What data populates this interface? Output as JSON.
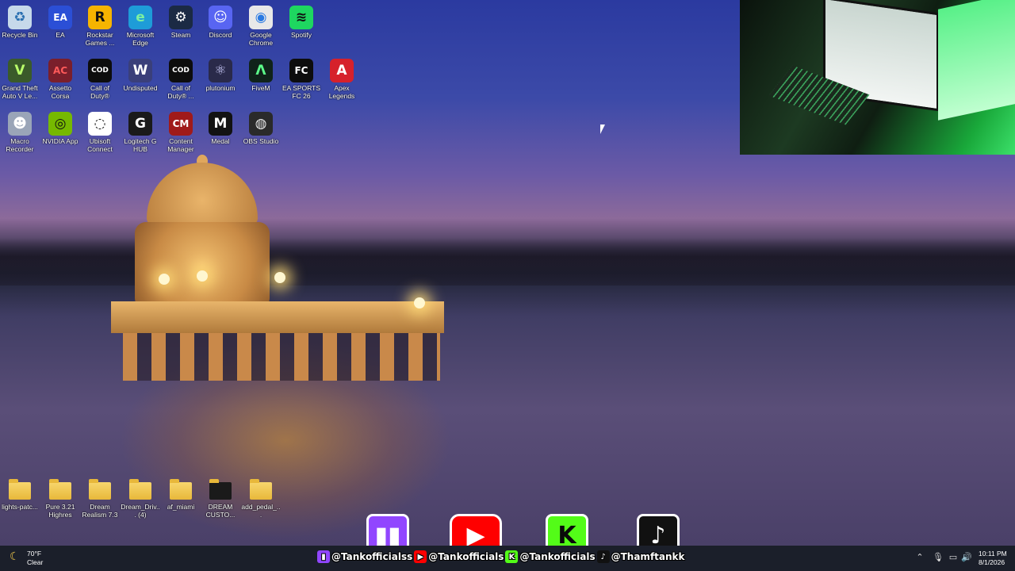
{
  "desktop_icons": [
    {
      "label": "Recycle Bin",
      "icon": "recycle-bin-icon",
      "glyph": "♻",
      "bg": "#c6d9ea",
      "fg": "#2a6fb0"
    },
    {
      "label": "EA",
      "icon": "ea-icon",
      "glyph": "EA",
      "bg": "#2b4fd6",
      "fg": "#ffffff"
    },
    {
      "label": "Rockstar Games ...",
      "icon": "rockstar-icon",
      "glyph": "R",
      "bg": "#f6b400",
      "fg": "#111111"
    },
    {
      "label": "Microsoft Edge",
      "icon": "edge-icon",
      "glyph": "e",
      "bg": "#1e9cd8",
      "fg": "#7cf0a0"
    },
    {
      "label": "Steam",
      "icon": "steam-icon",
      "glyph": "⚙",
      "bg": "#1b2a44",
      "fg": "#ffffff"
    },
    {
      "label": "Discord",
      "icon": "discord-icon",
      "glyph": "☺",
      "bg": "#5865f2",
      "fg": "#ffffff"
    },
    {
      "label": "Google Chrome",
      "icon": "chrome-icon",
      "glyph": "◉",
      "bg": "#e8e8e8",
      "fg": "#2a7ae2"
    },
    {
      "label": "Spotify",
      "icon": "spotify-icon",
      "glyph": "≋",
      "bg": "#1ed760",
      "fg": "#111111"
    },
    {
      "label": "Grand Theft Auto V Le...",
      "icon": "gta-icon",
      "glyph": "V",
      "bg": "#3a5a2a",
      "fg": "#b9ff6a"
    },
    {
      "label": "Assetto Corsa",
      "icon": "assetto-corsa-icon",
      "glyph": "AC",
      "bg": "#7a1f2b",
      "fg": "#ff5a5a"
    },
    {
      "label": "Call of Duty®",
      "icon": "cod-icon",
      "glyph": "COD",
      "bg": "#0d0d0d",
      "fg": "#ffffff"
    },
    {
      "label": "Undisputed",
      "icon": "undisputed-icon",
      "glyph": "W",
      "bg": "#3a3f7a",
      "fg": "#ffffff"
    },
    {
      "label": "Call of Duty® ...",
      "icon": "cod2-icon",
      "glyph": "COD",
      "bg": "#0d0d0d",
      "fg": "#ffffff"
    },
    {
      "label": "plutonium",
      "icon": "plutonium-icon",
      "glyph": "⚛",
      "bg": "#2a2a4a",
      "fg": "#cfcfff"
    },
    {
      "label": "FiveM",
      "icon": "fivem-icon",
      "glyph": "Λ",
      "bg": "#10231a",
      "fg": "#5cff8a"
    },
    {
      "label": "EA SPORTS FC 26",
      "icon": "fc26-icon",
      "glyph": "FC",
      "bg": "#0d0d0d",
      "fg": "#ffffff"
    },
    {
      "label": "Apex Legends",
      "icon": "apex-icon",
      "glyph": "A",
      "bg": "#d6212b",
      "fg": "#ffffff"
    },
    {
      "label": "Macro Recorder",
      "icon": "macro-recorder-icon",
      "glyph": "☻",
      "bg": "#9aa5b8",
      "fg": "#ffffff"
    },
    {
      "label": "NVIDIA App",
      "icon": "nvidia-icon",
      "glyph": "◎",
      "bg": "#76b900",
      "fg": "#111111"
    },
    {
      "label": "Ubisoft Connect",
      "icon": "ubisoft-icon",
      "glyph": "◌",
      "bg": "#ffffff",
      "fg": "#111111"
    },
    {
      "label": "Logitech G HUB",
      "icon": "logitech-icon",
      "glyph": "G",
      "bg": "#1a1a1a",
      "fg": "#ffffff"
    },
    {
      "label": "Content Manager",
      "icon": "content-manager-icon",
      "glyph": "CM",
      "bg": "#a01a1a",
      "fg": "#ffffff"
    },
    {
      "label": "Medal",
      "icon": "medal-icon",
      "glyph": "M",
      "bg": "#121212",
      "fg": "#ffffff"
    },
    {
      "label": "OBS Studio",
      "icon": "obs-icon",
      "glyph": "◍",
      "bg": "#2a2a2a",
      "fg": "#e8e8e8"
    }
  ],
  "folder_icons": [
    {
      "label": "lights-patc..."
    },
    {
      "label": "Pure 3.21 Highres"
    },
    {
      "label": "Dream Realism 7.3"
    },
    {
      "label": "Dream_Driv... (4)"
    },
    {
      "label": "af_miami"
    },
    {
      "label": "DREAM CUSTO..."
    },
    {
      "label": "add_pedal_..."
    }
  ],
  "social_big": [
    {
      "name": "twitch",
      "glyph": "▮▮",
      "bg": "#9146ff",
      "fg": "#ffffff"
    },
    {
      "name": "youtube",
      "glyph": "▶",
      "bg": "#ff0000",
      "fg": "#ffffff"
    },
    {
      "name": "kick",
      "glyph": "K",
      "bg": "#53fc18",
      "fg": "#0a0a0a"
    },
    {
      "name": "tiktok",
      "glyph": "♪",
      "bg": "#111111",
      "fg": "#ffffff"
    }
  ],
  "social_handles": [
    {
      "platform": "twitch",
      "text": "@Tankofficialss",
      "badge": "#9146ff",
      "glyph": "▮"
    },
    {
      "platform": "youtube",
      "text": "@Tankofficials",
      "badge": "#ff0000",
      "glyph": "▶"
    },
    {
      "platform": "kick",
      "text": "@Tankofficials",
      "badge": "#53fc18",
      "glyph": "K"
    },
    {
      "platform": "tiktok",
      "text": "@Thamftankk",
      "badge": "#111111",
      "glyph": "♪"
    }
  ],
  "taskbar": {
    "weather": {
      "temp": "70°F",
      "condition": "Clear",
      "icon": "moon-icon"
    },
    "clock": {
      "time": "10:11 PM",
      "date": "8/1/2026"
    },
    "tray_icons": [
      "chevron-up-icon",
      "microphone-icon",
      "display-icon",
      "speaker-icon"
    ]
  }
}
